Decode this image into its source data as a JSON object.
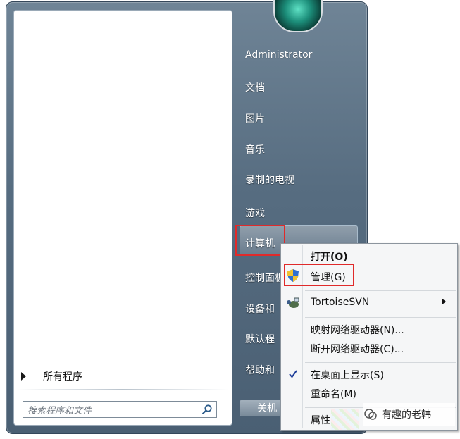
{
  "start_menu": {
    "user_name": "Administrator",
    "right_items": [
      "文档",
      "图片",
      "音乐",
      "录制的电视",
      "游戏",
      "计算机",
      "控制面板",
      "设备和",
      "默认程",
      "帮助和"
    ],
    "all_programs_label": "所有程序",
    "search_placeholder": "搜索程序和文件",
    "shutdown_label": "关机"
  },
  "context_menu": {
    "items": [
      {
        "label": "打开(O)",
        "bold": true
      },
      {
        "label": "管理(G)"
      },
      {
        "label": "TortoiseSVN"
      },
      {
        "label": "映射网络驱动器(N)..."
      },
      {
        "label": "断开网络驱动器(C)..."
      },
      {
        "label": "在桌面上显示(S)",
        "checked": true
      },
      {
        "label": "重命名(M)"
      },
      {
        "label": "属性"
      }
    ]
  },
  "watermark": {
    "text": "有趣的老韩"
  },
  "colors": {
    "highlight_border": "#e02a2a",
    "menu_background": "#f5f6f7",
    "start_menu_blue": "#566c80"
  },
  "icons": [
    "shield-icon",
    "tortoise-svn-icon",
    "check-icon",
    "search-icon",
    "submenu-arrow-icon",
    "wechat-icon"
  ]
}
